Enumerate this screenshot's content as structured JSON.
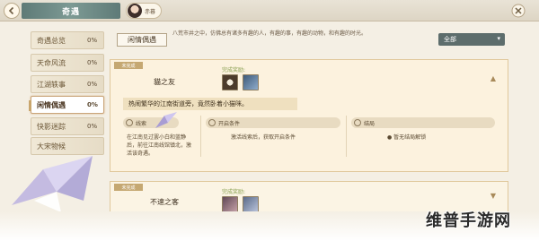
{
  "header": {
    "title": "奇遇",
    "player_name": "赤暮"
  },
  "sidebar": {
    "items": [
      {
        "label": "奇遇总览",
        "pct": "0%"
      },
      {
        "label": "天命风流",
        "pct": "0%"
      },
      {
        "label": "江湖轶事",
        "pct": "0%"
      },
      {
        "label": "闲情偶遇",
        "pct": "0%"
      },
      {
        "label": "快影迷踪",
        "pct": "0%"
      },
      {
        "label": "大宋物候",
        "pct": ""
      }
    ],
    "active_index": 3
  },
  "main": {
    "category": "闲情偶遇",
    "description": "八荒市井之中，仿佛总有诸多有趣的人，有趣的事，有趣的动物，和有趣的时光。",
    "filter": "全部"
  },
  "cards": [
    {
      "stamp": "未完成",
      "name": "貓之友",
      "reward_label": "完成奖励:",
      "quote": "热闹繁华的江南街道旁，竟然卧着小猫咪。",
      "phase1": {
        "title": "线索",
        "text": "在江南见过罢小白和蓝静后，前往江南线馆镇北，激活该奇遇。"
      },
      "phase2": {
        "title": "开启条件",
        "text": "激活线索后，获取开启条件"
      },
      "phase3": {
        "title": "结局",
        "text": "暂无结局解锁"
      }
    },
    {
      "stamp": "未完成",
      "name": "不速之客",
      "reward_label": "完成奖励:"
    }
  ],
  "watermark": "维普手游网"
}
